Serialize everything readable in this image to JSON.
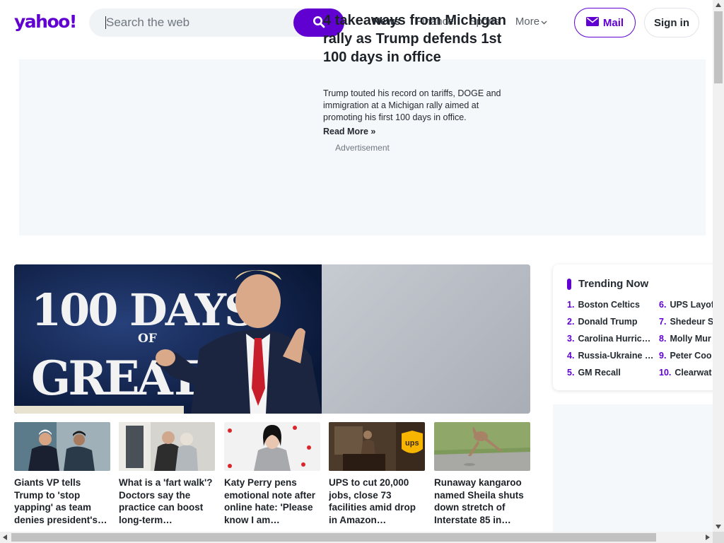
{
  "header": {
    "logo": "yahoo!",
    "search_placeholder": "Search the web",
    "nav": [
      "News",
      "Finance",
      "Sports",
      "More"
    ],
    "mail_label": "Mail",
    "signin_label": "Sign in"
  },
  "ad": {
    "label": "Advertisement"
  },
  "hero": {
    "title": "4 takeaways from Michigan rally as Trump defends 1st 100 days in office",
    "description": "Trump touted his record on tariffs, DOGE and immigration at a Michigan rally aimed at promoting his first 100 days in office.",
    "read_more": "Read More »",
    "image_text_line1": "100 DAYS",
    "image_text_line2": "OF",
    "image_text_line3": "GREATNE"
  },
  "cards": [
    {
      "title": "Giants VP tells Trump to 'stop yapping' as team denies president's…"
    },
    {
      "title": "What is a 'fart walk'? Doctors say the practice can boost long-term…"
    },
    {
      "title": "Katy Perry pens emotional note after online hate: 'Please know I am…"
    },
    {
      "title": "UPS to cut 20,000 jobs, close 73 facilities amid drop in Amazon…"
    },
    {
      "title": "Runaway kangaroo named Sheila shuts down stretch of Interstate 85 in…"
    }
  ],
  "trending": {
    "title": "Trending Now",
    "items": [
      {
        "num": "1.",
        "label": "Boston Celtics"
      },
      {
        "num": "2.",
        "label": "Donald Trump"
      },
      {
        "num": "3.",
        "label": "Carolina Hurric…"
      },
      {
        "num": "4.",
        "label": "Russia-Ukraine …"
      },
      {
        "num": "5.",
        "label": "GM Recall"
      },
      {
        "num": "6.",
        "label": "UPS Layof"
      },
      {
        "num": "7.",
        "label": "Shedeur Sa"
      },
      {
        "num": "8.",
        "label": "Molly Mur"
      },
      {
        "num": "9.",
        "label": "Peter Coo"
      },
      {
        "num": "10.",
        "label": "Clearwat"
      }
    ]
  },
  "colors": {
    "brand": "#6001d2",
    "text": "#232a31",
    "muted": "#6e7780"
  }
}
